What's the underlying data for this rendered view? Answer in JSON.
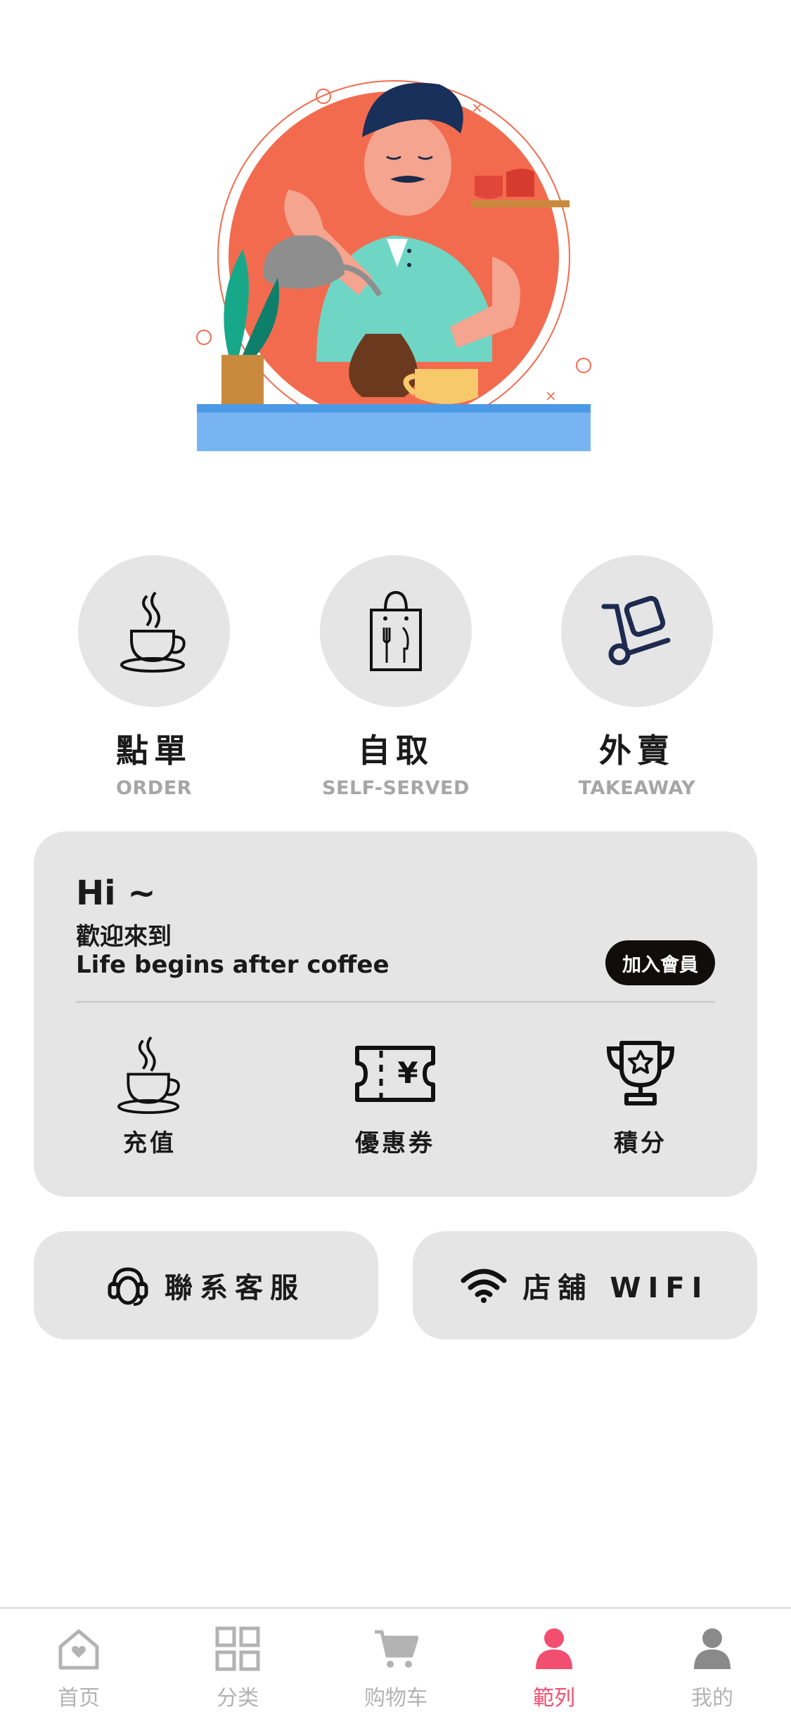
{
  "colors": {
    "accent": "#f24f70",
    "card": "#e5e5e5",
    "tab_inactive": "#b3b3b3",
    "join_bg": "#120d0d"
  },
  "services": [
    {
      "cn": "點單",
      "en": "ORDER",
      "icon": "coffee-cup-icon"
    },
    {
      "cn": "自取",
      "en": "SELF-SERVED",
      "icon": "shopping-bag-icon"
    },
    {
      "cn": "外賣",
      "en": "TAKEAWAY",
      "icon": "hand-truck-icon"
    }
  ],
  "member": {
    "greeting": "Hi ~",
    "welcome": "歡迎來到",
    "slogan": "Life begins after coffee",
    "join_label": "加入會員",
    "perks": [
      {
        "label": "充值",
        "icon": "coffee-cup-icon"
      },
      {
        "label": "優惠券",
        "icon": "coupon-icon"
      },
      {
        "label": "積分",
        "icon": "trophy-icon"
      }
    ]
  },
  "actions": {
    "support_label": "聯系客服",
    "wifi_label": "店舖 WIFI"
  },
  "tabs": [
    {
      "label": "首页",
      "icon": "home-icon",
      "active": false
    },
    {
      "label": "分类",
      "icon": "grid-icon",
      "active": false
    },
    {
      "label": "购物车",
      "icon": "cart-icon",
      "active": false
    },
    {
      "label": "範列",
      "icon": "user-icon",
      "active": true
    },
    {
      "label": "我的",
      "icon": "user-icon",
      "active": false
    }
  ]
}
